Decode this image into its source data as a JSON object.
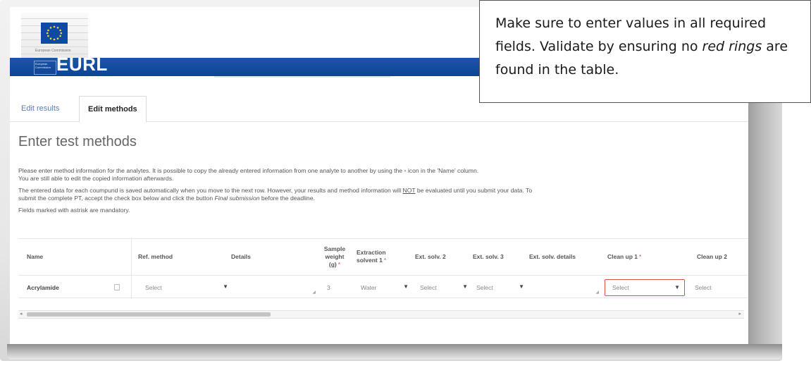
{
  "header": {
    "brand": "EURL",
    "ec_label": "European Commission",
    "ec_sub": "European Commission"
  },
  "tabs": [
    {
      "label": "Edit results",
      "active": false
    },
    {
      "label": "Edit methods",
      "active": true
    }
  ],
  "page": {
    "title": "Enter test methods",
    "intro_line1": "Please enter method information for the analytes. It is possible to copy the already entered information from one analyte to another by using the ▫ icon in the 'Name' column.",
    "intro_line2": "You are still able to edit the copied information afterwards.",
    "save_line_a": "The entered data for each coumpund is saved automatically when you move to the next row. However, your results and method information will ",
    "save_not": "NOT",
    "save_line_b": " be evaluated until you submit your data. To",
    "save_line_c": "submit the complete PT, accept the check box below and click the button ",
    "final_submission": "Final submission",
    "save_line_d": " before the deadline.",
    "mandatory_note": "Fields marked with astrisk are mandatory."
  },
  "table": {
    "columns": [
      {
        "label": "Name",
        "required": false
      },
      {
        "label": "Ref. method",
        "required": false
      },
      {
        "label": "Details",
        "required": false
      },
      {
        "label": "Sample weight (g)",
        "required": true
      },
      {
        "label": "Extraction solvent 1",
        "required": true
      },
      {
        "label": "Ext. solv. 2",
        "required": false
      },
      {
        "label": "Ext. solv. 3",
        "required": false
      },
      {
        "label": "Ext. solv. details",
        "required": false
      },
      {
        "label": "Clean up 1",
        "required": true
      },
      {
        "label": "Clean up 2",
        "required": false
      }
    ],
    "row": {
      "name": "Acrylamide",
      "ref_method": "Select",
      "details": "",
      "sample_weight": "3",
      "extraction_solvent_1": "Water",
      "ext_solv_2": "Select",
      "ext_solv_3": "Select",
      "ext_solv_details": "",
      "clean_up_1": "Select",
      "clean_up_2": "Select"
    },
    "required_marker": "*",
    "error_color": "#d9534f"
  },
  "callout": {
    "text_a": "Make sure to enter values in all required fields. Validate by ensuring no ",
    "text_em": "red rings",
    "text_b": " are found in the table."
  },
  "icons": {
    "copy": "copy-icon",
    "dropdown": "caret-down-icon",
    "scroll_left": "arrow-left-icon",
    "scroll_right": "arrow-right-icon"
  },
  "colors": {
    "brand_blue": "#0f4494",
    "tab_link": "#5a7fb5",
    "error": "#d9534f"
  }
}
